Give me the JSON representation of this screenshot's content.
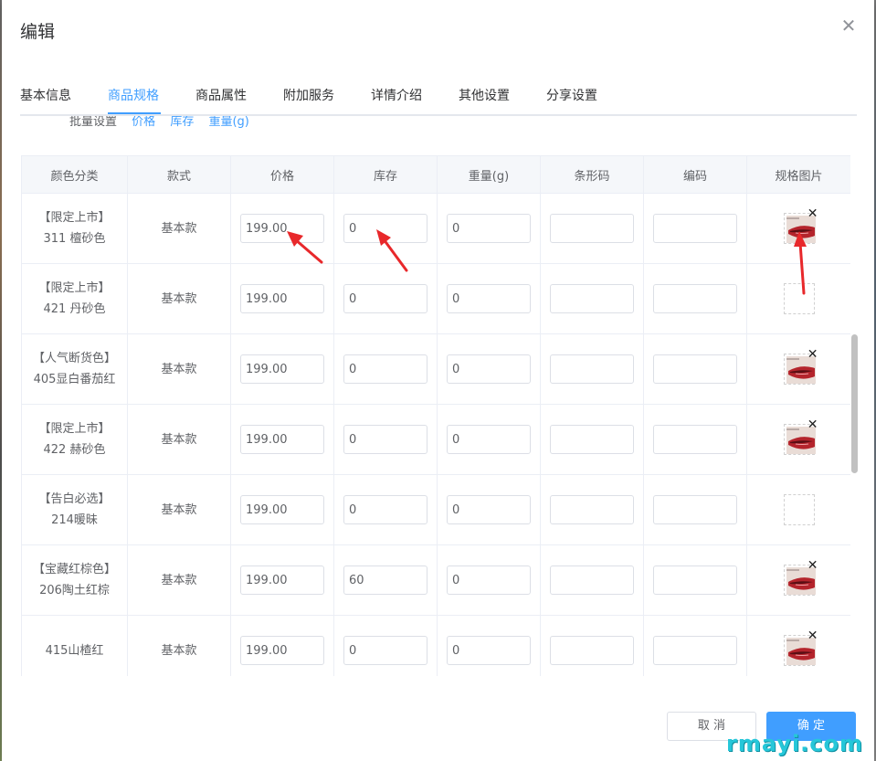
{
  "dialog": {
    "title": "编辑",
    "close_icon": "close-icon"
  },
  "tabs": [
    {
      "label": "基本信息",
      "active": false
    },
    {
      "label": "商品规格",
      "active": true
    },
    {
      "label": "商品属性",
      "active": false
    },
    {
      "label": "附加服务",
      "active": false
    },
    {
      "label": "详情介绍",
      "active": false
    },
    {
      "label": "其他设置",
      "active": false
    },
    {
      "label": "分享设置",
      "active": false
    }
  ],
  "batch": {
    "label": "批量设置",
    "links": [
      "价格",
      "库存",
      "重量(g)"
    ]
  },
  "table": {
    "headers": [
      "颜色分类",
      "款式",
      "价格",
      "库存",
      "重量(g)",
      "条形码",
      "编码",
      "规格图片"
    ],
    "rows": [
      {
        "name": "【限定上市】311 檀砂色",
        "style": "基本款",
        "price": "199.00",
        "stock": "0",
        "weight": "0",
        "barcode": "",
        "code": "",
        "image": true
      },
      {
        "name": "【限定上市】421 丹砂色",
        "style": "基本款",
        "price": "199.00",
        "stock": "0",
        "weight": "0",
        "barcode": "",
        "code": "",
        "image": false
      },
      {
        "name": "【人气断货色】405显白番茄红",
        "style": "基本款",
        "price": "199.00",
        "stock": "0",
        "weight": "0",
        "barcode": "",
        "code": "",
        "image": true
      },
      {
        "name": "【限定上市】422 赫砂色",
        "style": "基本款",
        "price": "199.00",
        "stock": "0",
        "weight": "0",
        "barcode": "",
        "code": "",
        "image": true
      },
      {
        "name": "【告白必选】214暖昧",
        "style": "基本款",
        "price": "199.00",
        "stock": "0",
        "weight": "0",
        "barcode": "",
        "code": "",
        "image": false
      },
      {
        "name": "【宝藏红棕色】206陶土红棕",
        "style": "基本款",
        "price": "199.00",
        "stock": "60",
        "weight": "0",
        "barcode": "",
        "code": "",
        "image": true
      },
      {
        "name": "415山楂红",
        "style": "基本款",
        "price": "199.00",
        "stock": "0",
        "weight": "0",
        "barcode": "",
        "code": "",
        "image": true
      }
    ]
  },
  "footer": {
    "cancel_label": "取 消",
    "ok_label": "确 定"
  },
  "watermark": "rmayi.com",
  "colors": {
    "accent": "#409eff",
    "annotation_arrow": "#e8282b",
    "watermark": "#26c7d9"
  }
}
